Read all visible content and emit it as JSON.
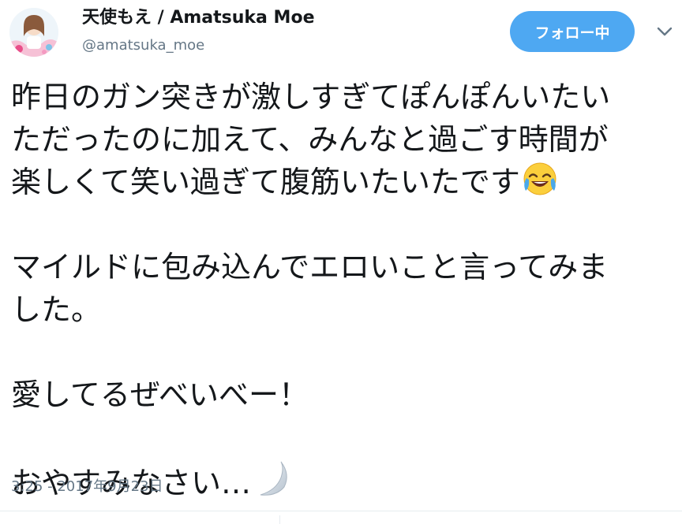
{
  "user": {
    "display_name": "天使もえ / Amatsuka Moe",
    "screen_name": "@amatsuka_moe",
    "avatar_icon": "profile-photo-avatar"
  },
  "follow_button": {
    "label": "フォロー中"
  },
  "menu": {
    "icon": "chevron-down-icon"
  },
  "tweet": {
    "line1": "昨日のガン突きが激しすぎてぽんぽんいたい",
    "line2": "ただったのに加えて、みんなと過ごす時間が",
    "line3": "楽しくて笑い過ぎて腹筋いたいたです",
    "line3_emoji": "face-with-tears-of-joy-emoji",
    "line4": "マイルドに包み込んでエロいこと言ってみま",
    "line5": "した。",
    "line6": "愛してるぜべいべー！",
    "line7": "おやすみなさい…",
    "line7_emoji": "crescent-moon-emoji"
  },
  "timestamp": "3:25 - 2017年9月23日",
  "colors": {
    "follow_button": "#4ea8f2",
    "secondary_text": "#657786",
    "primary_text": "#14171a"
  }
}
